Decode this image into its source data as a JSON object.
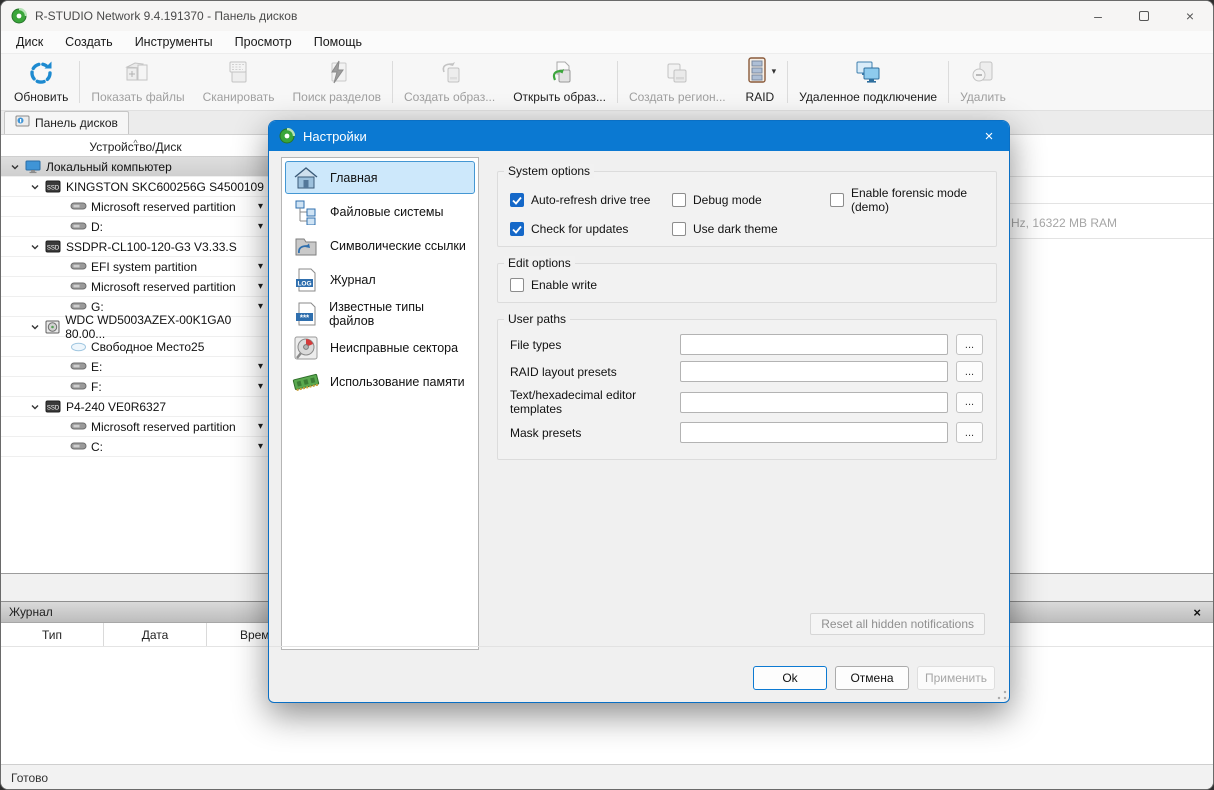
{
  "window": {
    "title": "R-STUDIO Network 9.4.191370 - Панель дисков"
  },
  "icons": {
    "minimize": "–",
    "close": "×",
    "dropdown": "▾",
    "log_close": "×"
  },
  "menu": {
    "items": [
      "Диск",
      "Создать",
      "Инструменты",
      "Просмотр",
      "Помощь"
    ]
  },
  "toolbar": {
    "items": [
      {
        "label": "Обновить",
        "enabled": true
      },
      {
        "label": "Показать файлы",
        "enabled": false
      },
      {
        "label": "Сканировать",
        "enabled": false
      },
      {
        "label": "Поиск разделов",
        "enabled": false
      },
      {
        "label": "Создать образ...",
        "enabled": false
      },
      {
        "label": "Открыть образ...",
        "enabled": true
      },
      {
        "label": "Создать регион...",
        "enabled": false
      },
      {
        "label": "RAID",
        "enabled": true,
        "has_dropdown": true
      },
      {
        "label": "Удаленное подключение",
        "enabled": true
      },
      {
        "label": "Удалить",
        "enabled": false
      }
    ]
  },
  "tab": {
    "label": "Панель дисков"
  },
  "device_tree": {
    "header": "Устройство/Диск",
    "sort_indicator": "^",
    "rows": [
      {
        "label": "Локальный компьютер",
        "icon": "computer",
        "selected": true
      },
      {
        "label": "KINGSTON SKC600256G S4500109",
        "icon": "ssd"
      },
      {
        "label": "Microsoft reserved partition",
        "icon": "partition"
      },
      {
        "label": "D:",
        "icon": "partition"
      },
      {
        "label": "SSDPR-CL100-120-G3 V3.33.S",
        "icon": "ssd"
      },
      {
        "label": "EFI system partition",
        "icon": "partition"
      },
      {
        "label": "Microsoft reserved partition",
        "icon": "partition"
      },
      {
        "label": "G:",
        "icon": "partition"
      },
      {
        "label": "WDC WD5003AZEX-00K1GA0 80.00...",
        "icon": "hdd"
      },
      {
        "label": "Свободное Место25",
        "icon": "free-space"
      },
      {
        "label": "E:",
        "icon": "partition"
      },
      {
        "label": "F:",
        "icon": "partition"
      },
      {
        "label": "P4-240 VE0R6327",
        "icon": "ssd"
      },
      {
        "label": "Microsoft reserved partition",
        "icon": "partition"
      },
      {
        "label": "C:",
        "icon": "partition"
      }
    ]
  },
  "right_panel": {
    "info_text": "Hz, 16322 MB RAM"
  },
  "log_panel": {
    "title": "Журнал",
    "columns": [
      "Тип",
      "Дата",
      "Время"
    ]
  },
  "status_bar": {
    "text": "Готово"
  },
  "dialog": {
    "title": "Настройки",
    "sidebar": {
      "items": [
        {
          "label": "Главная",
          "selected": true
        },
        {
          "label": "Файловые системы"
        },
        {
          "label": "Символические ссылки"
        },
        {
          "label": "Журнал"
        },
        {
          "label": "Известные типы файлов"
        },
        {
          "label": "Неисправные сектора"
        },
        {
          "label": "Использование памяти"
        }
      ]
    },
    "system_options": {
      "title": "System options",
      "checkboxes": [
        {
          "label": "Auto-refresh drive tree",
          "checked": true
        },
        {
          "label": "Debug mode",
          "checked": false
        },
        {
          "label": "Enable forensic mode (demo)",
          "checked": false
        },
        {
          "label": "Check for updates",
          "checked": true
        },
        {
          "label": "Use dark theme",
          "checked": false
        }
      ]
    },
    "edit_options": {
      "title": "Edit options",
      "checkboxes": [
        {
          "label": "Enable write",
          "checked": false
        }
      ]
    },
    "user_paths": {
      "title": "User paths",
      "rows": [
        {
          "label": "File types",
          "value": "",
          "browse": "..."
        },
        {
          "label": "RAID layout presets",
          "value": "",
          "browse": "..."
        },
        {
          "label": "Text/hexadecimal editor templates",
          "value": "",
          "browse": "..."
        },
        {
          "label": "Mask presets",
          "value": "",
          "browse": "..."
        }
      ]
    },
    "reset_button": "Reset all hidden notifications",
    "buttons": {
      "ok": "Ok",
      "cancel": "Отмена",
      "apply": "Применить"
    }
  },
  "colors": {
    "accent_blue": "#0b79d2",
    "checkbox_blue": "#1568c8",
    "selected_item_bg": "#cde8fb",
    "selected_item_border": "#4497d3"
  }
}
